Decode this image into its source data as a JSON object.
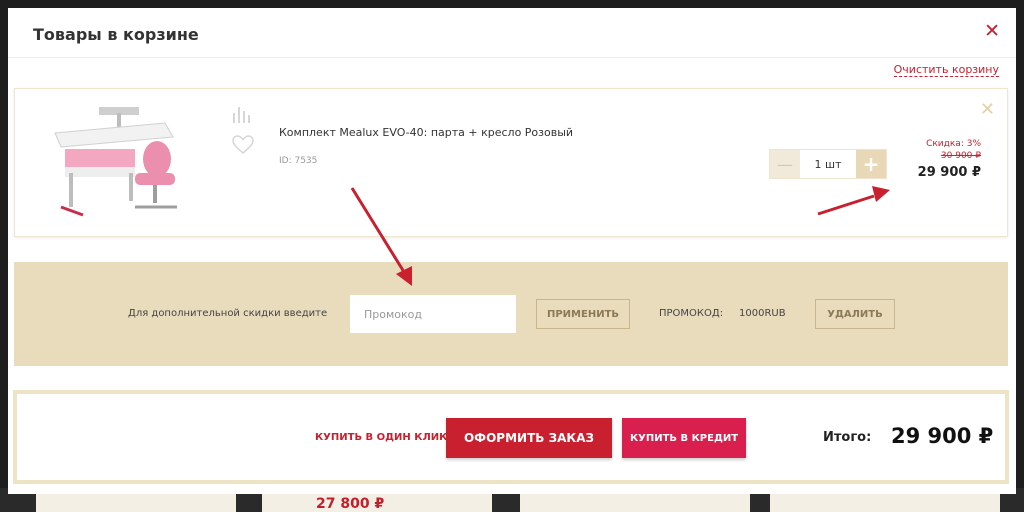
{
  "header": {
    "title": "Товары в корзине"
  },
  "cart": {
    "clear_label": "Очистить корзину",
    "item": {
      "name": "Комплект Mealux EVO-40: парта + кресло Розовый",
      "id_label": "ID: 7535",
      "quantity": "1 шт",
      "discount": "Скидка: 3%",
      "old_price": "30 900 ₽",
      "new_price": "29 900 ₽"
    }
  },
  "promo": {
    "label": "Для дополнительной скидки введите",
    "placeholder": "Промокод",
    "apply_label": "ПРИМЕНИТЬ",
    "code_label": "ПРОМОКОД:",
    "code_value": "1000RUB",
    "delete_label": "УДАЛИТЬ"
  },
  "checkout": {
    "one_click_label": "КУПИТЬ В ОДИН КЛИК",
    "order_label": "ОФОРМИТЬ ЗАКАЗ",
    "credit_label": "КУПИТЬ В КРЕДИТ",
    "total_label": "Итого:",
    "total_value": "29 900 ₽"
  },
  "background": {
    "price_fragment": "27 800 ₽"
  },
  "icons": {
    "close": "close-icon",
    "remove": "remove-icon",
    "compare": "stats-icon",
    "favorite": "heart-icon",
    "minus": "minus-icon",
    "plus": "plus-icon"
  },
  "colors": {
    "accent": "#c8202f",
    "credit": "#d81f4d",
    "promo_bg": "#e9dcbd"
  }
}
